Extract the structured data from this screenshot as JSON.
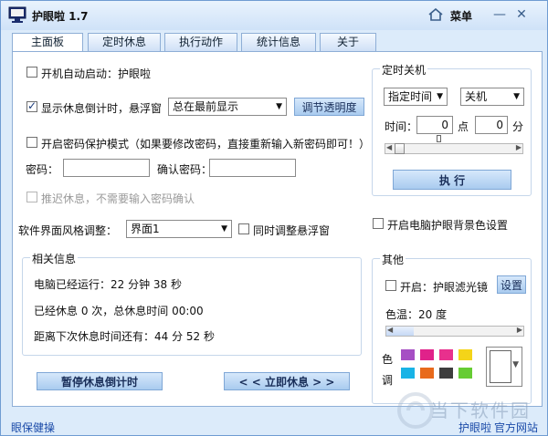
{
  "app": {
    "title": "护眼啦 1.7",
    "menu": "菜单"
  },
  "tabs": [
    "主面板",
    "定时休息",
    "执行动作",
    "统计信息",
    "关于"
  ],
  "main": {
    "autostart_label": "开机自动启动：护眼啦",
    "show_countdown_label": "显示休息倒计时，悬浮窗",
    "float_mode": "总在最前显示",
    "adjust_opacity_button": "调节透明度",
    "password_mode_label": "开启密码保护模式（如果要修改密码，直接重新输入新密码即可！）",
    "password_label": "密码：",
    "confirm_password_label": "确认密码：",
    "delay_rest_label": "推迟休息，不需要输入密码确认",
    "skin_label": "软件界面风格调整：",
    "skin_value": "界面1",
    "sync_float_label": "同时调整悬浮窗",
    "eye_bg_label": "开启电脑护眼背景色设置"
  },
  "info": {
    "title": "相关信息",
    "uptime": "电脑已经运行：22 分钟 38 秒",
    "rest_count": "已经休息 0 次，总休息时间 00:00",
    "next_rest": "距离下次休息时间还有：44 分 52 秒",
    "pause_button": "暂停休息倒计时",
    "rest_now_button": "< < 立即休息 > >"
  },
  "shutdown": {
    "title": "定时关机",
    "mode": "指定时间",
    "action": "关机",
    "time_label": "时间：",
    "hour": "0",
    "point_label": "点",
    "minute": "0",
    "minute_label": "分",
    "slider_value": 0.0,
    "execute_button": "执 行"
  },
  "other": {
    "title": "其他",
    "filter_label": "开启：护眼滤光镜",
    "settings_button": "设置",
    "color_temp_label": "色温：20 度",
    "color_temp_fraction": 0.2,
    "color_label_1": "色",
    "color_label_2": "调",
    "swatches": [
      "#a64fc4",
      "#e0228a",
      "#e8308d",
      "#f4d419",
      "#19b3e6",
      "#e86a1c",
      "#3d3d3d",
      "#66cc33"
    ],
    "selected_color": "#ffffff"
  },
  "footer": {
    "left": "眼保健操",
    "right1": "护眼啦",
    "right2": "官方网站"
  },
  "watermark": {
    "text": "当下软件园"
  }
}
